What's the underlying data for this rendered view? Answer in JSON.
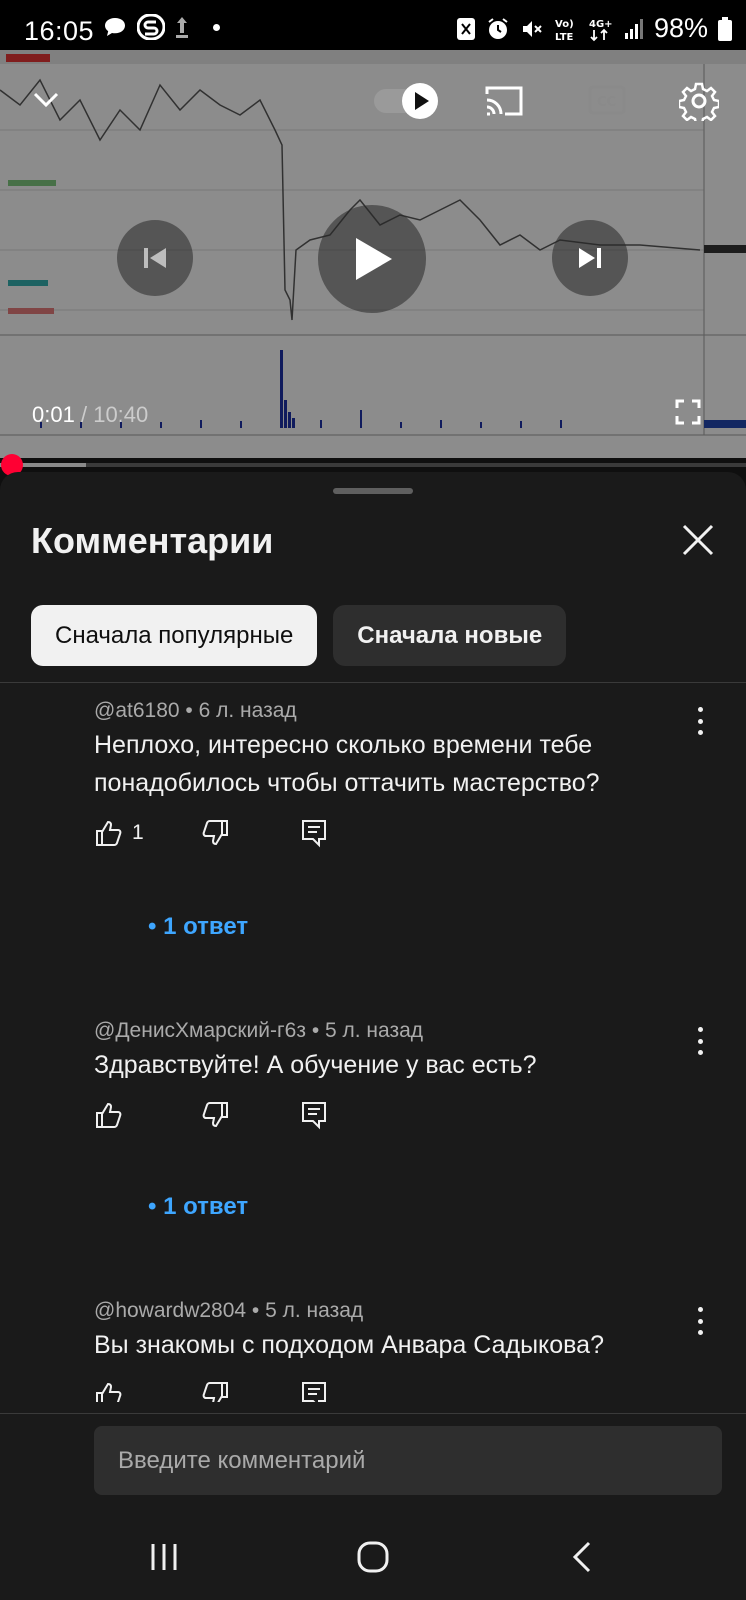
{
  "status_bar": {
    "time": "16:05",
    "battery": "98%",
    "network": "4G+"
  },
  "player": {
    "time_current": "0:01",
    "time_separator": "/",
    "time_total": "10:40",
    "progress_fraction": 0.001,
    "buffered_fraction": 0.115,
    "autoplay": "on"
  },
  "comments_panel": {
    "title": "Комментарии",
    "sort_chips": [
      {
        "label": "Сначала популярные",
        "selected": true
      },
      {
        "label": "Сначала новые",
        "selected": false
      }
    ],
    "comments": [
      {
        "author": "@at6180",
        "age": "6 л. назад",
        "text": "Неплохо,  интересно сколько времени тебе понадобилось чтобы оттачить мастерство?",
        "likes": "1",
        "replies": "• 1 ответ"
      },
      {
        "author": "@ДенисХмарский-г6з",
        "age": "5 л. назад",
        "text": "Здравствуйте! А обучение у вас есть?",
        "likes": "",
        "replies": "• 1 ответ"
      },
      {
        "author": "@howardw2804",
        "age": "5 л. назад",
        "text": "Вы знакомы с подходом Анвара Садыкова?",
        "likes": "",
        "replies": ""
      }
    ],
    "input_placeholder": "Введите комментарий"
  },
  "colors": {
    "accent_red": "#ff0033",
    "link_blue": "#3ea6ff",
    "sheet_bg": "#1a1a1a"
  }
}
